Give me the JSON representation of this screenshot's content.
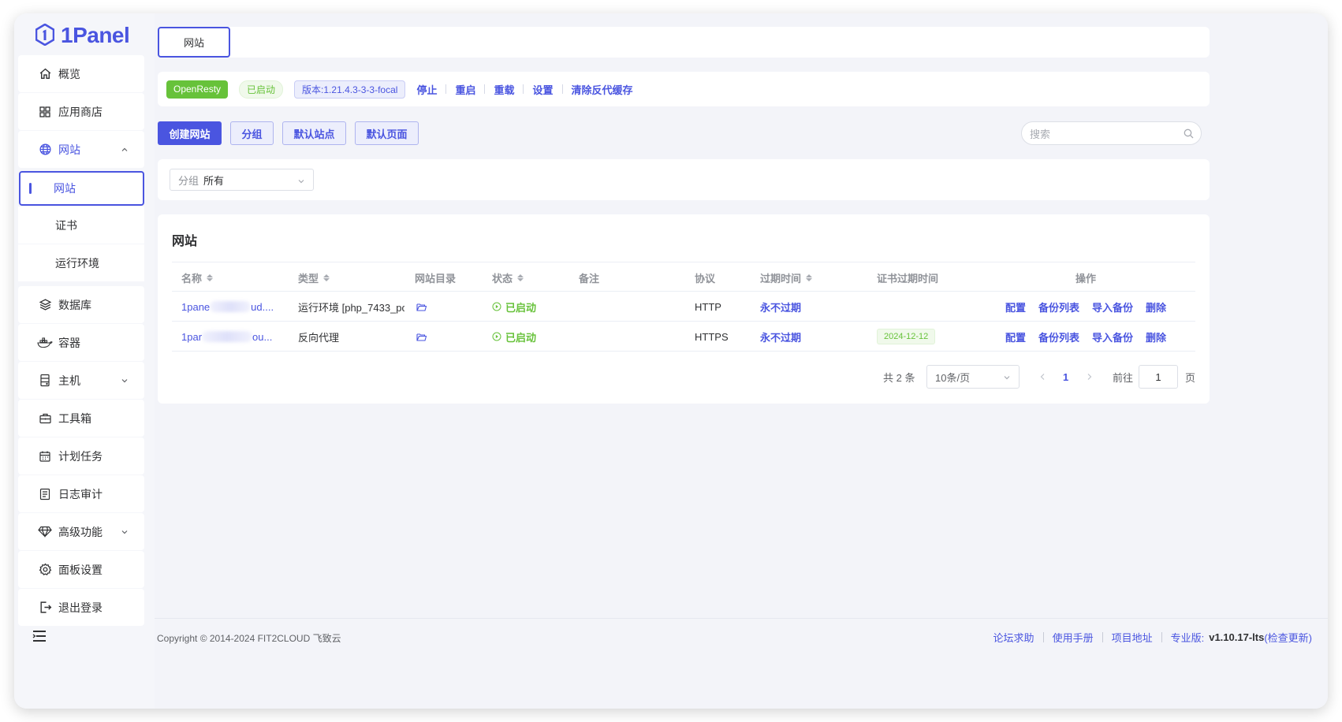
{
  "app": {
    "logo_text": "1Panel",
    "accent": "#4a55e0"
  },
  "sidebar": {
    "items": [
      {
        "label": "概览",
        "icon": "home-icon"
      },
      {
        "label": "应用商店",
        "icon": "grid-icon"
      },
      {
        "label": "网站",
        "icon": "globe-icon",
        "expanded": true,
        "children": [
          {
            "label": "网站",
            "active": true
          },
          {
            "label": "证书"
          },
          {
            "label": "运行环境"
          }
        ]
      },
      {
        "label": "数据库",
        "icon": "layers-icon"
      },
      {
        "label": "容器",
        "icon": "docker-icon"
      },
      {
        "label": "主机",
        "icon": "server-icon"
      },
      {
        "label": "工具箱",
        "icon": "toolbox-icon"
      },
      {
        "label": "计划任务",
        "icon": "calendar-icon"
      },
      {
        "label": "日志审计",
        "icon": "log-icon"
      },
      {
        "label": "高级功能",
        "icon": "diamond-icon"
      },
      {
        "label": "面板设置",
        "icon": "gear-icon"
      },
      {
        "label": "退出登录",
        "icon": "logout-icon"
      }
    ]
  },
  "tabs": {
    "active": "网站"
  },
  "status": {
    "server": "OpenResty",
    "state": "已启动",
    "version": "版本:1.21.4.3-3-3-focal",
    "actions": [
      "停止",
      "重启",
      "重载",
      "设置",
      "清除反代缓存"
    ]
  },
  "toolbar": {
    "create": "创建网站",
    "group": "分组",
    "default_site": "默认站点",
    "default_page": "默认页面",
    "search_placeholder": "搜索"
  },
  "filter": {
    "label": "分组",
    "value": "所有"
  },
  "table": {
    "title": "网站",
    "columns": [
      "名称",
      "类型",
      "网站目录",
      "状态",
      "备注",
      "协议",
      "过期时间",
      "证书过期时间",
      "操作"
    ],
    "rows": [
      {
        "name_start": "1pane",
        "name_end": "ud....",
        "type": "运行环境 [php_7433_pc",
        "status": "已启动",
        "protocol": "HTTP",
        "expire": "永不过期",
        "cert_expire": ""
      },
      {
        "name_start": "1par",
        "name_end": "ou...",
        "type": "反向代理",
        "status": "已启动",
        "protocol": "HTTPS",
        "expire": "永不过期",
        "cert_expire": "2024-12-12"
      }
    ],
    "row_actions": [
      "配置",
      "备份列表",
      "导入备份",
      "删除"
    ]
  },
  "pagination": {
    "total": "共 2 条",
    "page_size": "10条/页",
    "current": "1",
    "goto_label": "前往",
    "goto_value": "1",
    "page_suffix": "页"
  },
  "footer": {
    "copyright": "Copyright © 2014-2024 FIT2CLOUD 飞致云",
    "links": [
      "论坛求助",
      "使用手册",
      "项目地址"
    ],
    "edition_label": "专业版:",
    "version": "v1.10.17-lts",
    "check_update": "(检查更新)"
  }
}
